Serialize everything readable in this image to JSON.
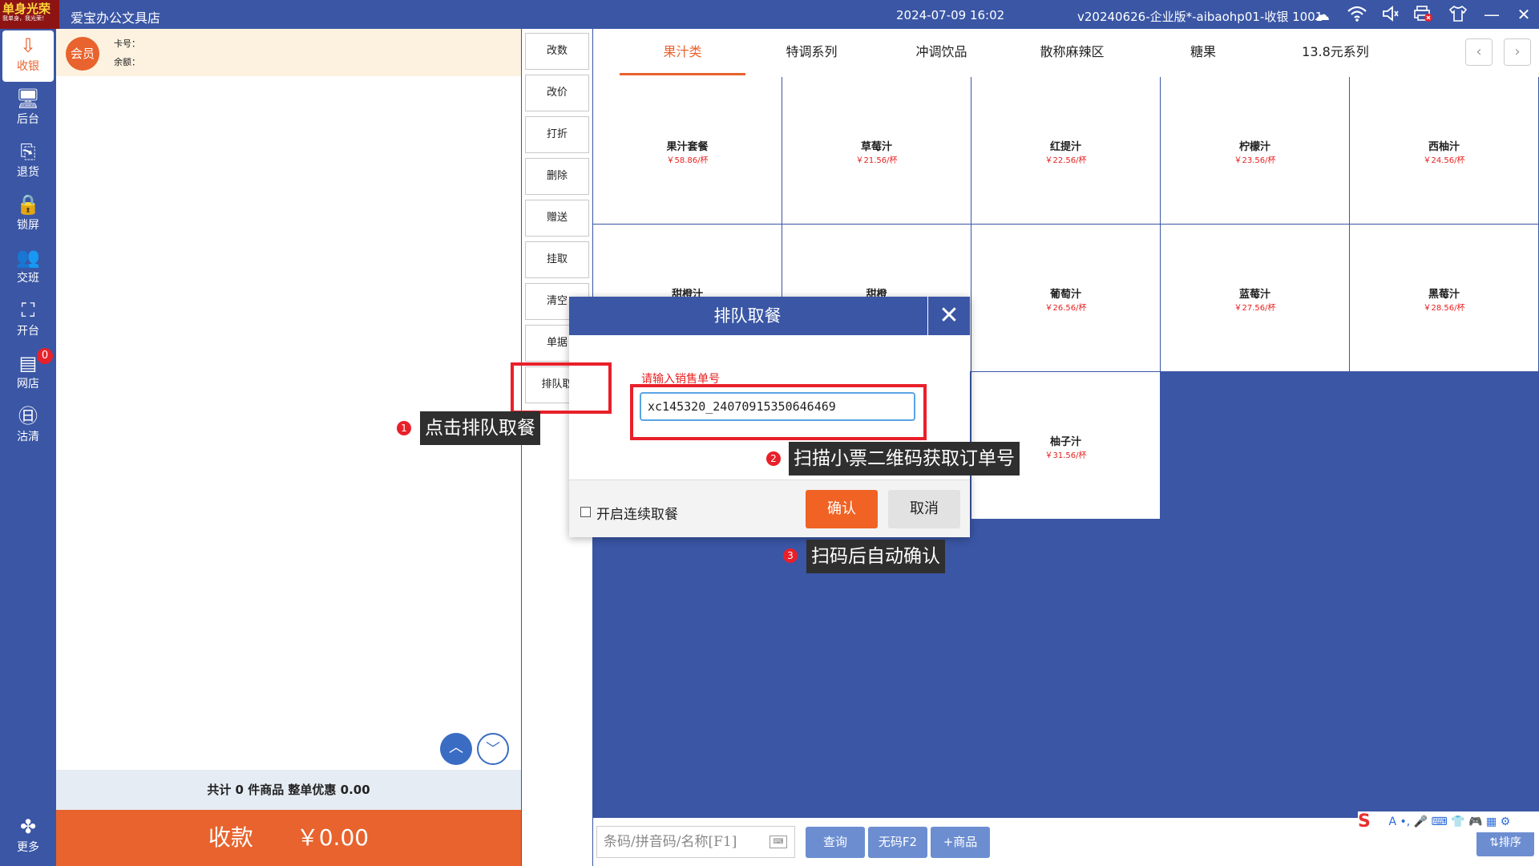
{
  "titlebar": {
    "logo_main": "单身光荣",
    "logo_sub": "我单身，我光荣！",
    "store_name": "爱宝办公文具店",
    "datetime": "2024-07-09 16:02",
    "version": "v20240626-企业版*-aibaohp01-收银 1001",
    "icons": [
      "cloud-icon",
      "wifi-icon",
      "speaker-icon",
      "printer-icon",
      "shirt-icon",
      "minimize-icon",
      "close-icon"
    ]
  },
  "nav": {
    "items": [
      {
        "label": "收银",
        "icon": "cashier-icon"
      },
      {
        "label": "后台",
        "icon": "monitor-icon"
      },
      {
        "label": "退货",
        "icon": "return-icon"
      },
      {
        "label": "锁屏",
        "icon": "lock-icon"
      },
      {
        "label": "交班",
        "icon": "users-icon"
      },
      {
        "label": "开台",
        "icon": "table-icon"
      },
      {
        "label": "网店",
        "icon": "store-icon"
      },
      {
        "label": "沽清",
        "icon": "sellout-icon"
      },
      {
        "label": "更多",
        "icon": "more-icon"
      }
    ],
    "store_badge": "0"
  },
  "member": {
    "avatar_label": "会员",
    "card_label": "卡号：",
    "balance_label": "余额："
  },
  "cart": {
    "summary": "共计 0 件商品 整单优惠 0.00",
    "pay_label": "收款",
    "pay_amount": "￥0.00"
  },
  "actions": [
    "改数",
    "改价",
    "打折",
    "删除",
    "赠送",
    "挂取",
    "清空",
    "单据",
    "排队取"
  ],
  "tabs": [
    "果汁类",
    "特调系列",
    "冲调饮品",
    "散称麻辣区",
    "糖果",
    "13.8元系列"
  ],
  "products": [
    {
      "name": "果汁套餐",
      "price": "￥58.86/杯"
    },
    {
      "name": "草莓汁",
      "price": "￥21.56/杯"
    },
    {
      "name": "红提汁",
      "price": "￥22.56/杯"
    },
    {
      "name": "柠檬汁",
      "price": "￥23.56/杯"
    },
    {
      "name": "西柚汁",
      "price": "￥24.56/杯"
    },
    {
      "name": "甜橙汁",
      "price": ""
    },
    {
      "name": "甜橙",
      "price": ""
    },
    {
      "name": "葡萄汁",
      "price": "￥26.56/杯"
    },
    {
      "name": "蓝莓汁",
      "price": "￥27.56/杯"
    },
    {
      "name": "黑莓汁",
      "price": "￥28.56/杯"
    },
    {
      "name": "柚子汁",
      "price": "￥31.56/杯"
    }
  ],
  "bottom": {
    "search_placeholder": "条码/拼音码/名称[F1]",
    "query_label": "查询",
    "nocode_label": "无码F2",
    "addproduct_label": "+商品",
    "sort_label": "⇅排序",
    "ime_text": "A •, 🎤 ⌨ 👕 🎮 ▦ ⚙"
  },
  "modal": {
    "title": "排队取餐",
    "prompt": "请输入销售单号",
    "order_value": "xc145320_24070915350646469",
    "continuous_label": "开启连续取餐",
    "confirm_label": "确认",
    "cancel_label": "取消"
  },
  "callouts": [
    {
      "step": "1",
      "text": "点击排队取餐"
    },
    {
      "step": "2",
      "text": "扫描小票二维码获取订单号"
    },
    {
      "step": "3",
      "text": "扫码后自动确认"
    }
  ],
  "colors": {
    "brand_blue": "#3a56a5",
    "accent_orange": "#e8632d",
    "price_red": "#e82020",
    "highlight_red": "#e8202a"
  }
}
